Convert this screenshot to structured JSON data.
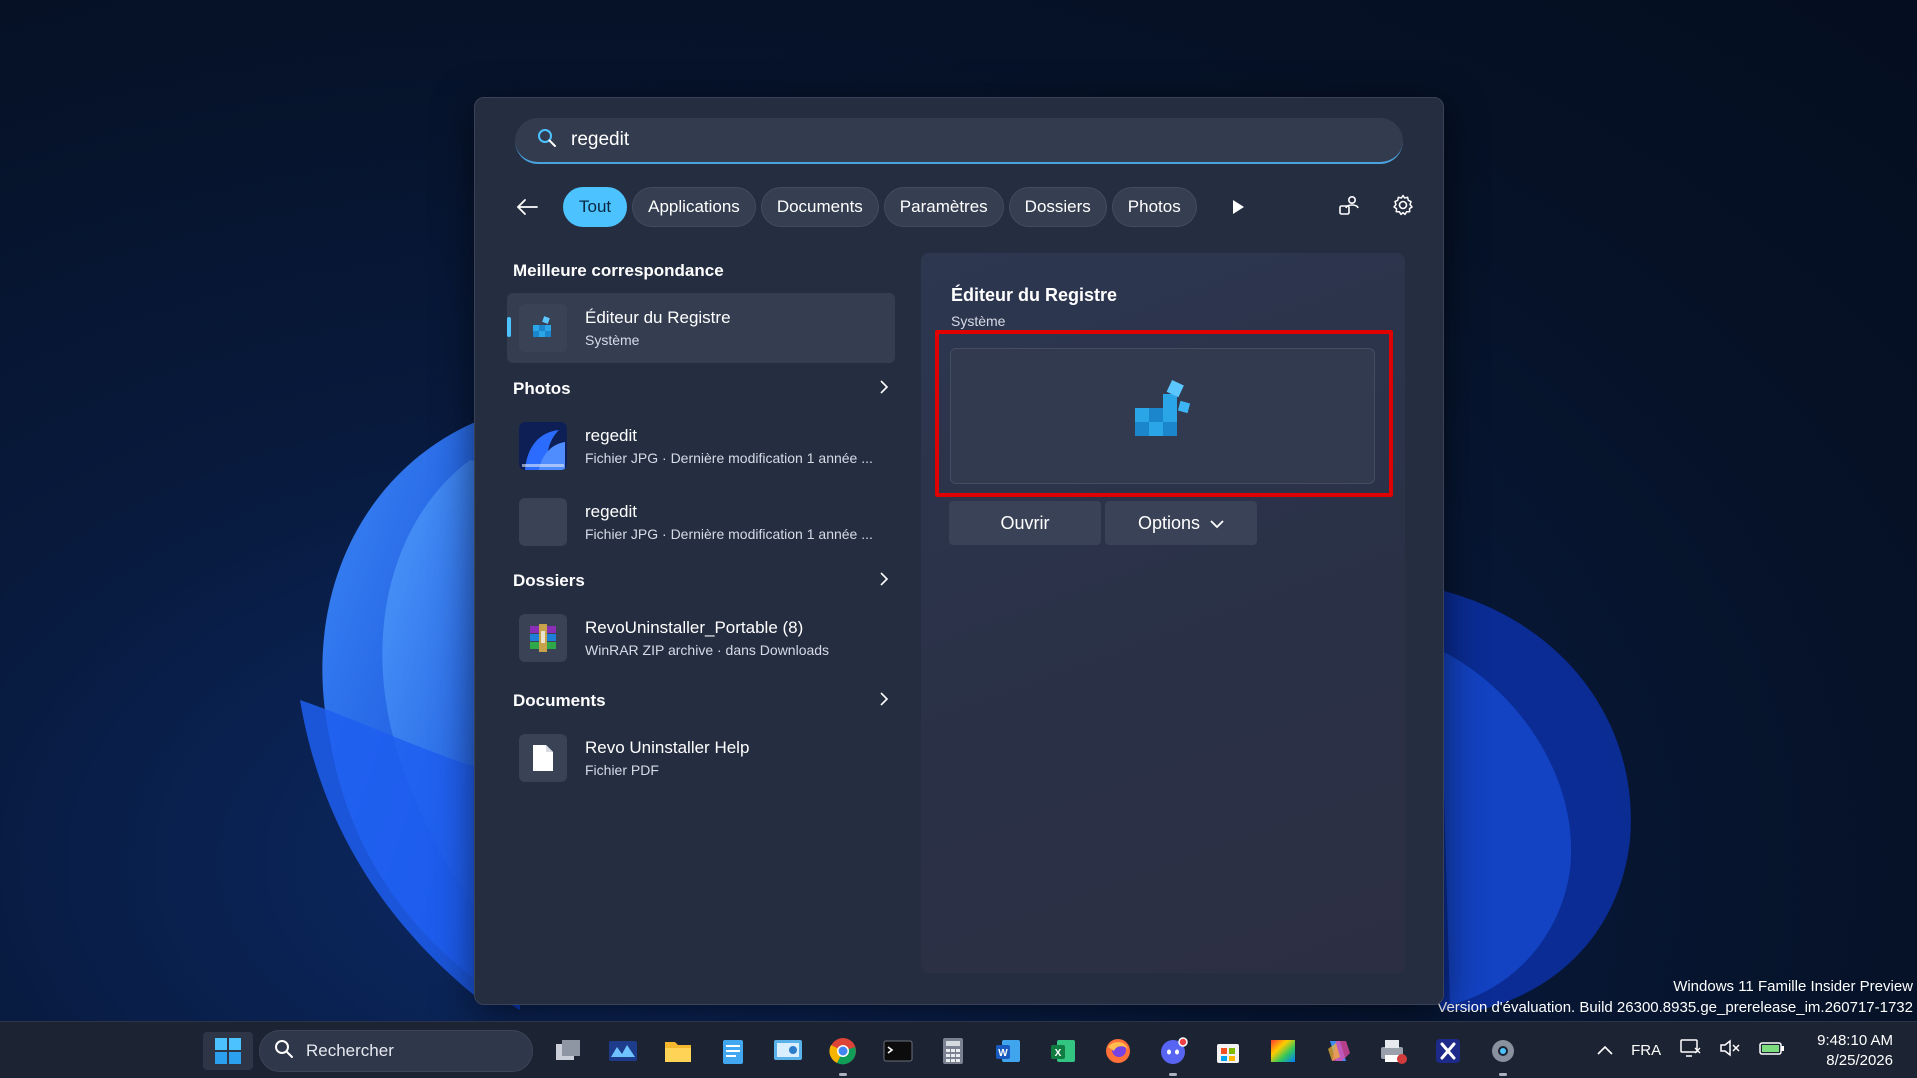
{
  "search": {
    "query": "regedit"
  },
  "filters": {
    "chips": [
      "Tout",
      "Applications",
      "Documents",
      "Paramètres",
      "Dossiers",
      "Photos"
    ],
    "active_index": 0
  },
  "results": {
    "best_match": {
      "heading": "Meilleure correspondance",
      "title": "Éditeur du Registre",
      "subtitle": "Système"
    },
    "photos": {
      "heading": "Photos",
      "items": [
        {
          "title": "regedit",
          "subtitle": "Fichier JPG · Dernière modification 1 année ..."
        },
        {
          "title": "regedit",
          "subtitle": "Fichier JPG · Dernière modification 1 année ..."
        }
      ]
    },
    "folders": {
      "heading": "Dossiers",
      "items": [
        {
          "title": "RevoUninstaller_Portable (8)",
          "subtitle": "WinRAR ZIP archive · dans Downloads"
        }
      ]
    },
    "documents": {
      "heading": "Documents",
      "items": [
        {
          "title": "Revo Uninstaller Help",
          "subtitle": "Fichier PDF"
        }
      ]
    }
  },
  "detail": {
    "title": "Éditeur du Registre",
    "subtitle": "Système",
    "open_label": "Ouvrir",
    "options_label": "Options",
    "highlight_color": "#e00000"
  },
  "watermark": {
    "line1": "Windows 11 Famille Insider Preview",
    "line2": "Version d'évaluation. Build 26300.8935.ge_prerelease_im.260717-1732"
  },
  "taskbar": {
    "search_label": "Rechercher",
    "apps": [
      "task-view-icon",
      "widgets-icon",
      "file-explorer-icon",
      "notepad-icon",
      "control-panel-icon",
      "chrome-icon",
      "terminal-icon",
      "calculator-icon",
      "word-icon",
      "excel-icon",
      "firefox-icon",
      "discord-icon",
      "store-icon",
      "color-app-icon",
      "copilot-icon",
      "printer-app-icon",
      "x-icon",
      "settings-icon"
    ],
    "language": "FRA",
    "time": "9:48:10 AM",
    "date": "8/25/2026"
  },
  "colors": {
    "accent": "#4cc2ff",
    "panel": "#252d40",
    "taskbar": "#1c2333"
  }
}
